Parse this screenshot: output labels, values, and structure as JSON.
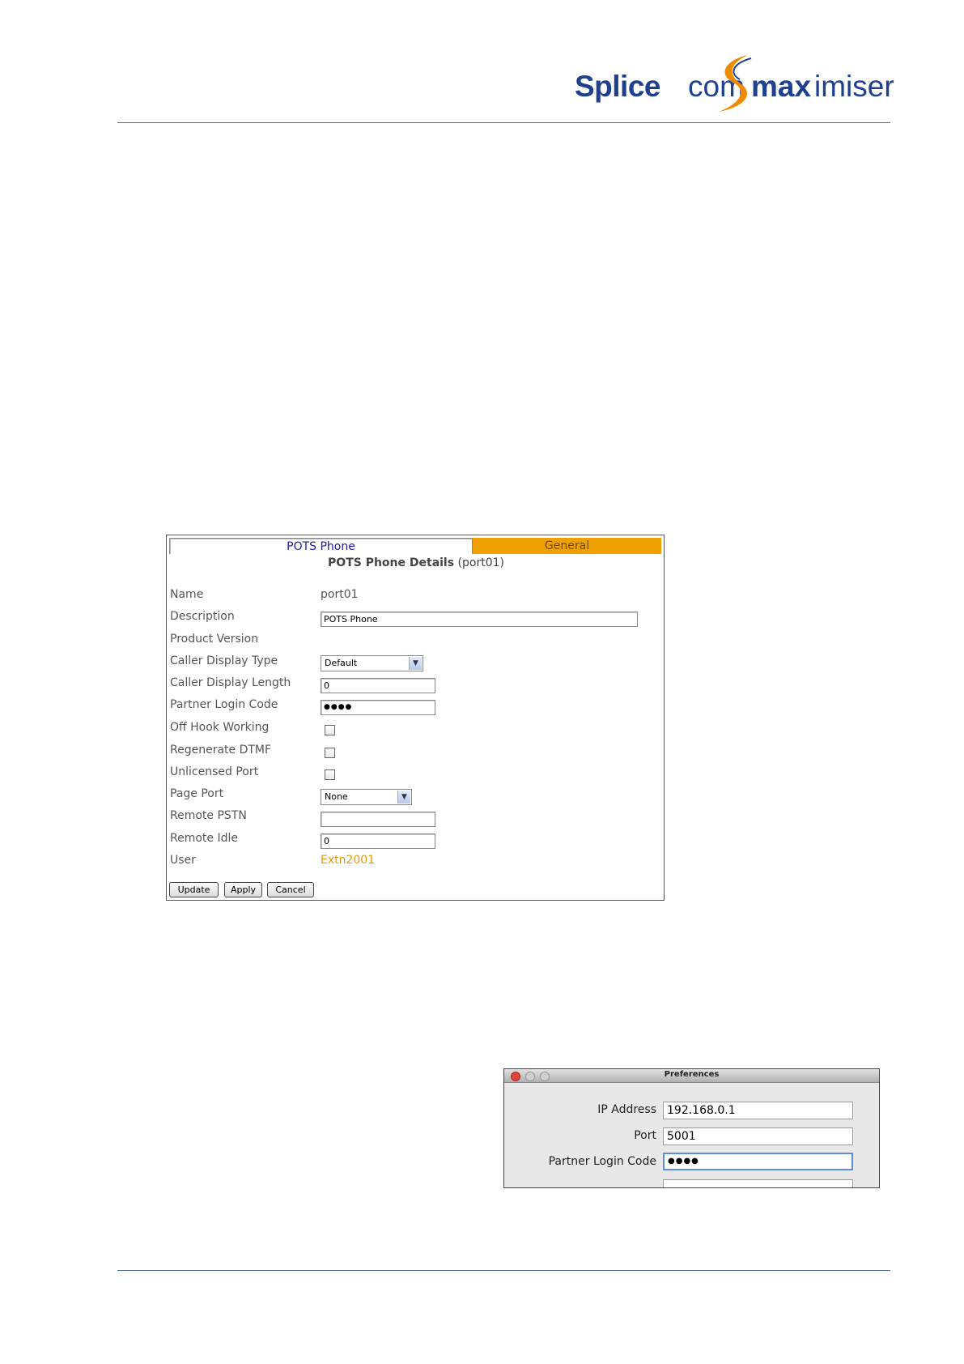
{
  "header": {
    "logo": {
      "splice": "Splice",
      "com": "com",
      "max": "max",
      "imiser": "imiser"
    },
    "brand_color": "#1f3f8f",
    "accent_color": "#f08a00"
  },
  "form": {
    "tabs": [
      {
        "label": "POTS Phone"
      },
      {
        "label": "General"
      }
    ],
    "title_bold": "POTS Phone Details",
    "title_suffix": "(port01)",
    "labels": {
      "name": "Name",
      "description": "Description",
      "product_version": "Product Version",
      "caller_display_type": "Caller Display Type",
      "caller_display_length": "Caller Display Length",
      "partner_login_code": "Partner Login Code",
      "off_hook_working": "Off Hook Working",
      "regenerate_dtmf": "Regenerate DTMF",
      "unlicensed_port": "Unlicensed Port",
      "page_port": "Page Port",
      "remote_pstn": "Remote PSTN",
      "remote_idle": "Remote Idle",
      "user": "User"
    },
    "values": {
      "name": "port01",
      "description": "POTS Phone",
      "caller_display_type": "Default",
      "caller_display_length": "0",
      "partner_login_code": "●●●●",
      "off_hook_working": false,
      "regenerate_dtmf": false,
      "unlicensed_port": false,
      "page_port": "None",
      "remote_pstn": "",
      "remote_idle": "0",
      "user": "Extn2001"
    },
    "buttons": {
      "update": "Update",
      "apply": "Apply",
      "cancel": "Cancel"
    }
  },
  "prefs": {
    "title": "Preferences",
    "fields": {
      "ip_address_label": "IP Address",
      "ip_address_value": "192.168.0.1",
      "port_label": "Port",
      "port_value": "5001",
      "partner_login_label": "Partner Login Code",
      "partner_login_value": "●●●●"
    }
  }
}
